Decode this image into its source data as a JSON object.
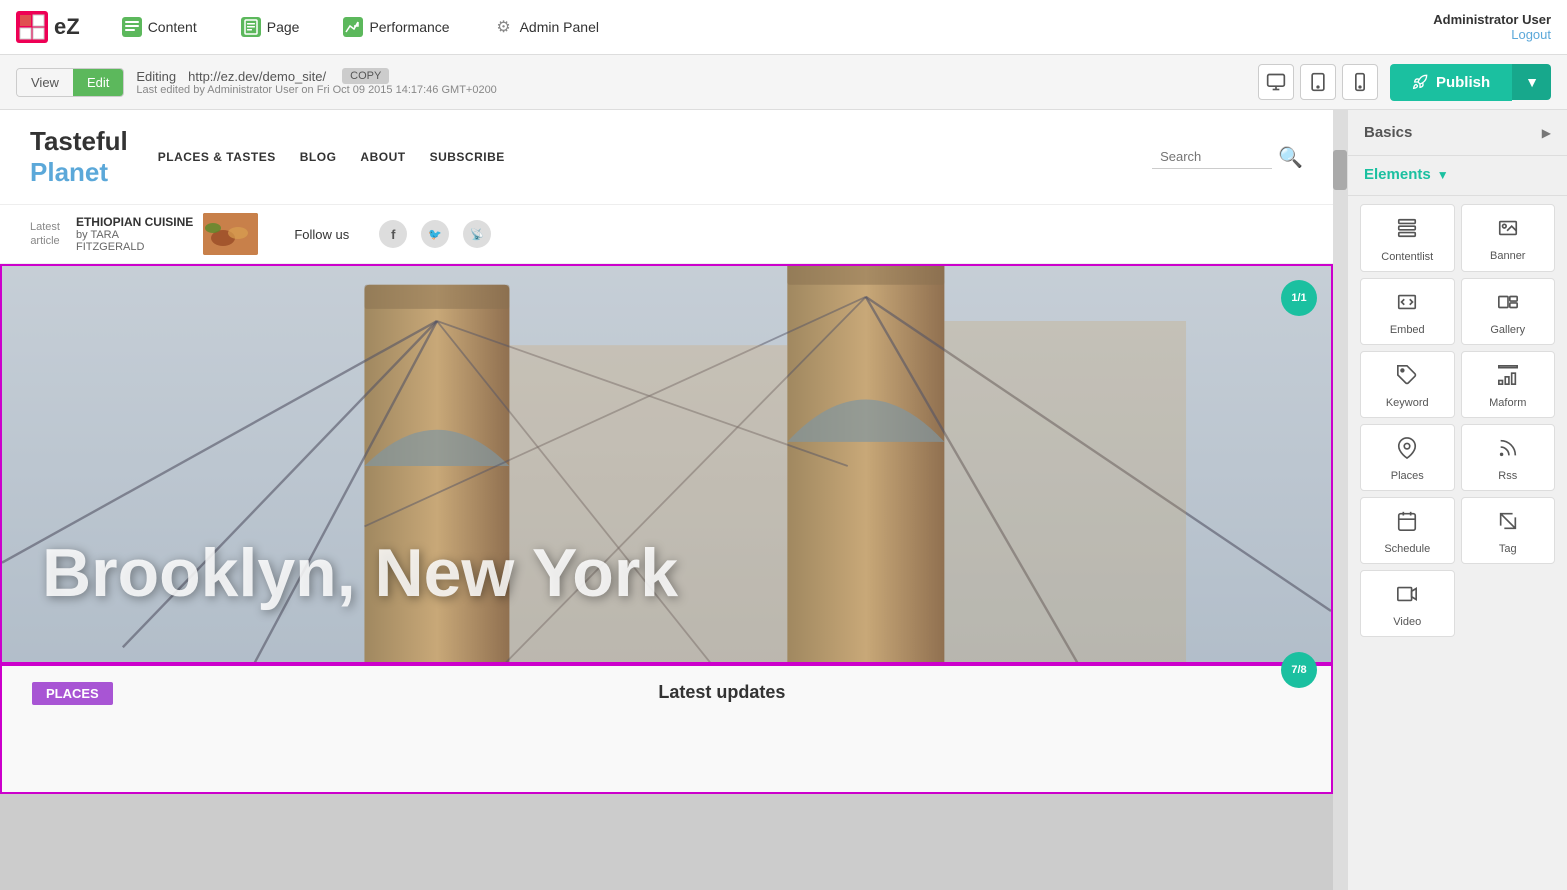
{
  "logo": {
    "icon": "□eZ",
    "text": "eZ"
  },
  "topnav": {
    "items": [
      {
        "id": "content",
        "label": "Content",
        "icon": "▤"
      },
      {
        "id": "page",
        "label": "Page",
        "icon": "▦"
      },
      {
        "id": "performance",
        "label": "Performance",
        "icon": "📈"
      },
      {
        "id": "admin",
        "label": "Admin Panel",
        "icon": "⚙"
      }
    ]
  },
  "user": {
    "name": "Administrator User",
    "logout": "Logout"
  },
  "toolbar": {
    "view_label": "View",
    "edit_label": "Edit",
    "editing_prefix": "Editing",
    "url": "http://ez.dev/demo_site/",
    "copy_label": "COPY",
    "last_edited": "Last edited by Administrator User on Fri Oct 09 2015 14:17:46 GMT+0200",
    "publish_label": "Publish"
  },
  "rightpanel": {
    "basics_label": "Basics",
    "elements_label": "Elements",
    "elements": [
      {
        "id": "contentlist",
        "label": "Contentlist",
        "icon": "☰"
      },
      {
        "id": "banner",
        "label": "Banner",
        "icon": "🖼"
      },
      {
        "id": "embed",
        "label": "Embed",
        "icon": "⬚"
      },
      {
        "id": "gallery",
        "label": "Gallery",
        "icon": "🖼"
      },
      {
        "id": "keyword",
        "label": "Keyword",
        "icon": "🏷"
      },
      {
        "id": "maform",
        "label": "Maform",
        "icon": "📊"
      },
      {
        "id": "places",
        "label": "Places",
        "icon": "📍"
      },
      {
        "id": "rss",
        "label": "Rss",
        "icon": "📡"
      },
      {
        "id": "schedule",
        "label": "Schedule",
        "icon": "📅"
      },
      {
        "id": "tag",
        "label": "Tag",
        "icon": "</>"
      },
      {
        "id": "video",
        "label": "Video",
        "icon": "🎬"
      }
    ]
  },
  "site": {
    "brand1": "Tasteful",
    "brand2": "Planet",
    "nav": [
      "PLACES & TASTES",
      "BLOG",
      "ABOUT",
      "SUBSCRIBE"
    ],
    "search_placeholder": "Search",
    "latest_article_label": "Latest\narticle",
    "article_title": "ETHIOPIAN CUISINE",
    "article_by": "by TARA",
    "article_author": "FITZGERALD",
    "follow_us": "Follow us",
    "hero_text": "Brooklyn, New York",
    "hero_badge": "1/1",
    "second_badge": "7/8",
    "places_tag": "PLACES",
    "latest_updates": "Latest updates"
  }
}
